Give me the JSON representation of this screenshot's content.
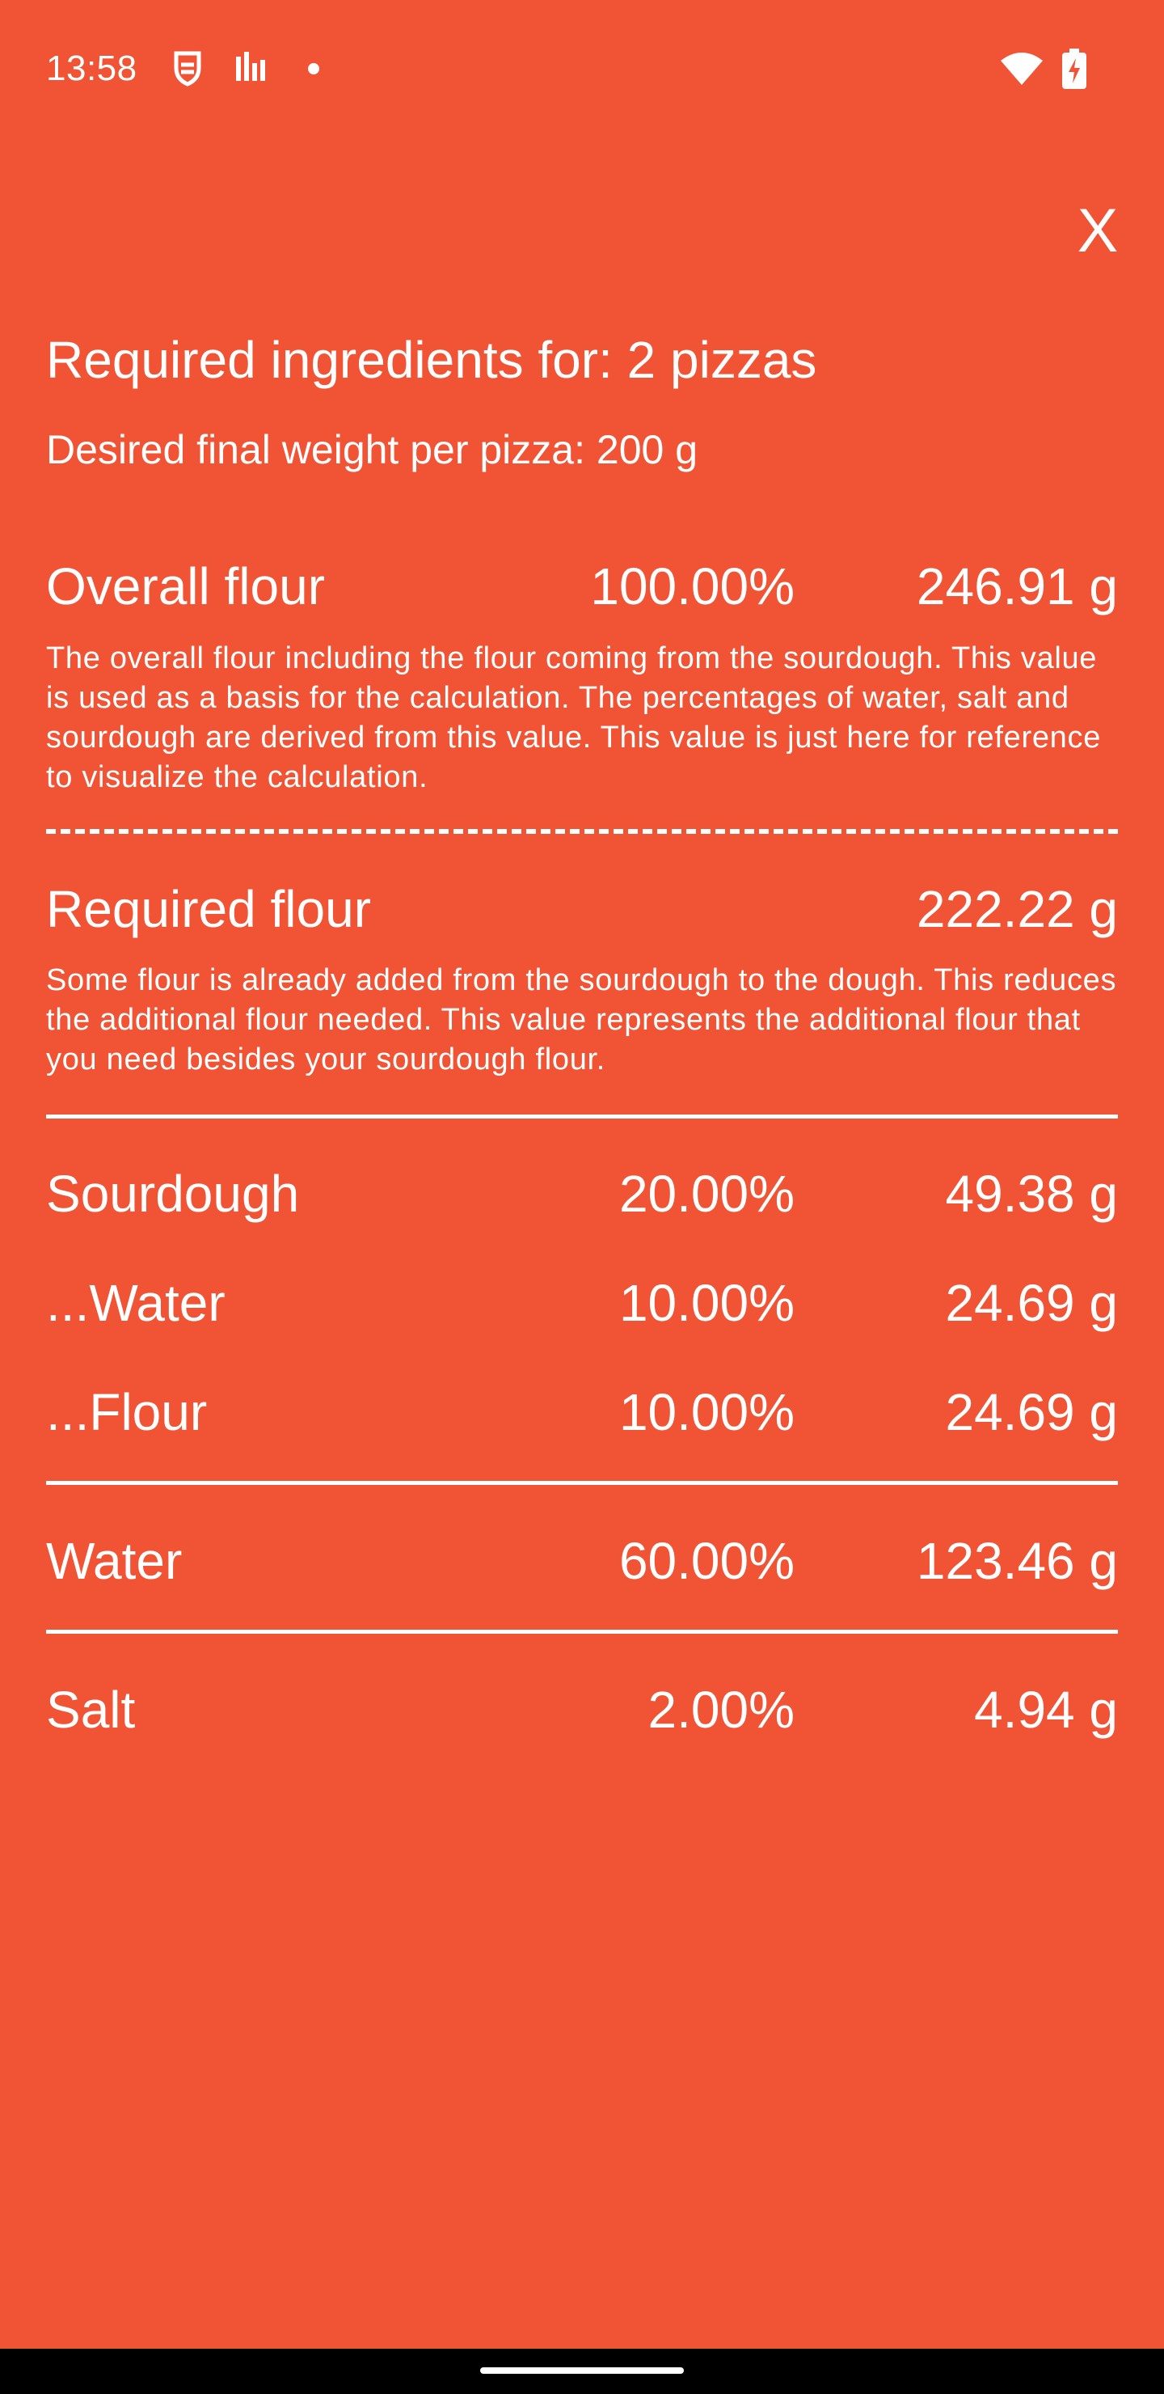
{
  "status_bar": {
    "time": "13:58",
    "icons": [
      "shield-icon",
      "signal-bars-icon",
      "dot-icon",
      "wifi-icon",
      "battery-icon"
    ]
  },
  "close_label": "X",
  "title": "Required ingredients for: 2 pizzas",
  "subtitle": "Desired final weight per pizza: 200 g",
  "overall_flour": {
    "name": "Overall flour",
    "percent": "100.00%",
    "amount": "246.91 g",
    "description": "The overall flour including the flour coming from the sourdough. This value is used as a basis for the calculation. The percentages of water, salt and sourdough are derived from this value. This value is just here for reference to visualize the calculation."
  },
  "required_flour": {
    "name": "Required flour",
    "amount": "222.22 g",
    "description": "Some flour is already added from the sourdough to the dough. This reduces the additional flour needed. This value represents the additional flour that you need besides your sourdough flour."
  },
  "sourdough": {
    "name": "Sourdough",
    "percent": "20.00%",
    "amount": "49.38 g",
    "water": {
      "name": "...Water",
      "percent": "10.00%",
      "amount": "24.69 g"
    },
    "flour": {
      "name": "...Flour",
      "percent": "10.00%",
      "amount": "24.69 g"
    }
  },
  "water": {
    "name": "Water",
    "percent": "60.00%",
    "amount": "123.46 g"
  },
  "salt": {
    "name": "Salt",
    "percent": "2.00%",
    "amount": "4.94 g"
  },
  "colors": {
    "background": "#F05434",
    "text": "#FFFFFF",
    "nav_bar": "#000000"
  }
}
